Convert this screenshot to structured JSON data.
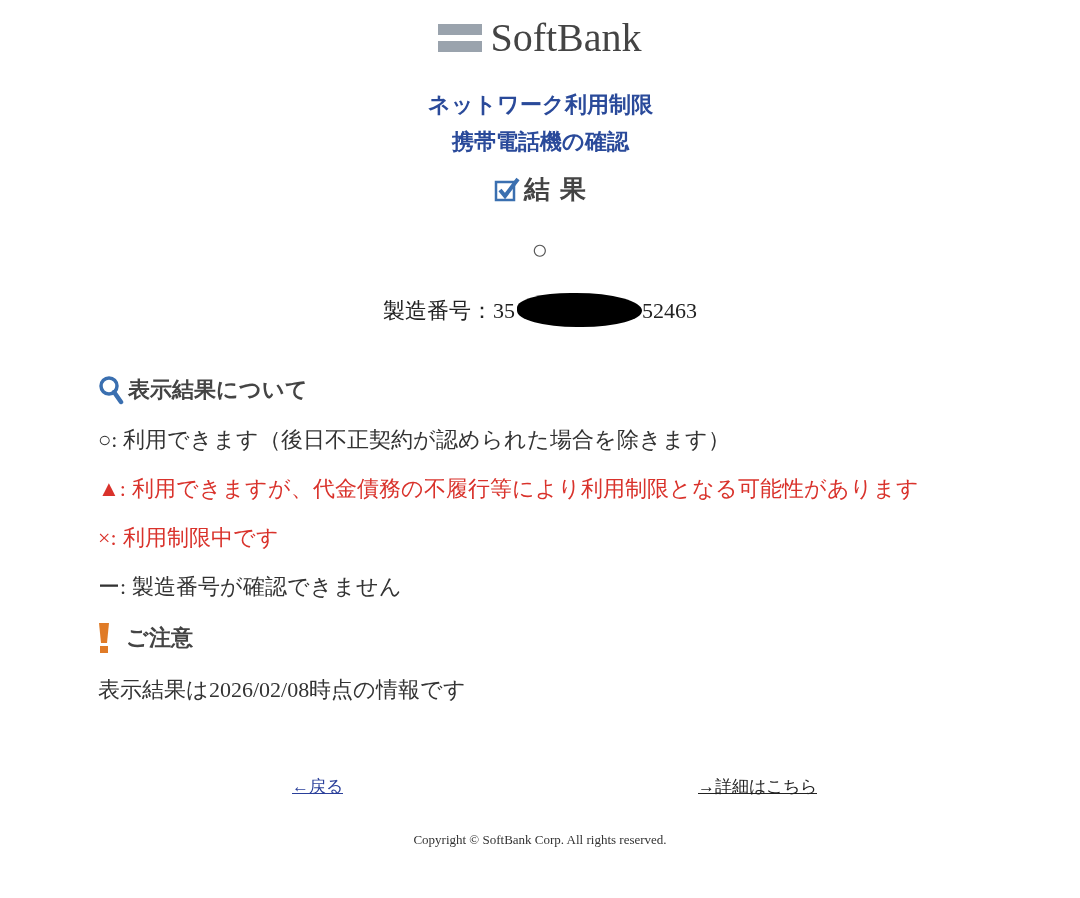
{
  "logo": {
    "text": "SoftBank"
  },
  "title_lines": [
    "ネットワーク利用制限",
    "携帯電話機の確認"
  ],
  "result": {
    "heading": "結 果",
    "symbol": "○"
  },
  "serial": {
    "label": "製造番号：35",
    "tail": "52463",
    "redacted": true
  },
  "legend": {
    "heading": "表示結果について",
    "items": [
      {
        "symbol": "○:",
        "text": "利用できます（後日不正契約が認められた場合を除きます）",
        "color": "#333333"
      },
      {
        "symbol": "▲:",
        "text": "利用できますが、代金債務の不履行等により利用制限となる可能性があります",
        "color": "#d9322b"
      },
      {
        "symbol": "×:",
        "text": "利用制限中です",
        "color": "#d9322b"
      },
      {
        "symbol": "ー:",
        "text": "製造番号が確認できません",
        "color": "#333333"
      }
    ]
  },
  "notice": {
    "heading": "ご注意",
    "text": "表示結果は2026/02/08時点の情報です"
  },
  "links": [
    {
      "text": "←戻る",
      "color": "#2a3f9a"
    },
    {
      "text": "→詳細はこちら",
      "color": "#222222"
    }
  ],
  "copyright": "Copyright © SoftBank Corp. All rights reserved."
}
